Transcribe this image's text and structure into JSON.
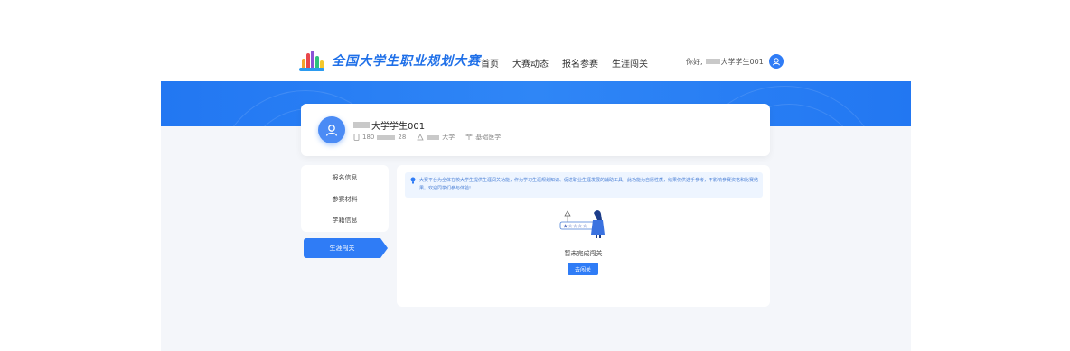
{
  "header": {
    "logo_text": "全国大学生职业规划大赛",
    "nav": [
      "首页",
      "大赛动态",
      "报名参赛",
      "生涯闯关"
    ],
    "greeting": "你好,",
    "user_name": "大学学生001"
  },
  "profile": {
    "name": "大学学生001",
    "phone_prefix": "180",
    "phone_suffix": "28",
    "school": "大学",
    "major": "基础医学"
  },
  "sidebar": {
    "items": [
      "报名信息",
      "参赛材料",
      "学籍信息",
      "生涯闯关"
    ],
    "active_index": 3
  },
  "content": {
    "notice": "大赛平台为全体在校大学生提供生涯闯关功能，作为学习生涯规划知识、促进职业生涯发展的辅助工具，此功能为自愿性质，结果仅供选手参考，不影响参赛资格和比赛结果。欢迎同学们参与体验!",
    "empty_text": "暂未完成闯关",
    "go_button": "去闯关"
  },
  "colors": {
    "primary": "#2f7cf6",
    "banner": "#2277f2",
    "notice_bg": "#eef5ff",
    "page_bg": "#f4f6fa"
  },
  "icons": [
    "logo-icon",
    "user-avatar-icon",
    "phone-icon",
    "school-icon",
    "major-icon",
    "bulb-icon"
  ]
}
